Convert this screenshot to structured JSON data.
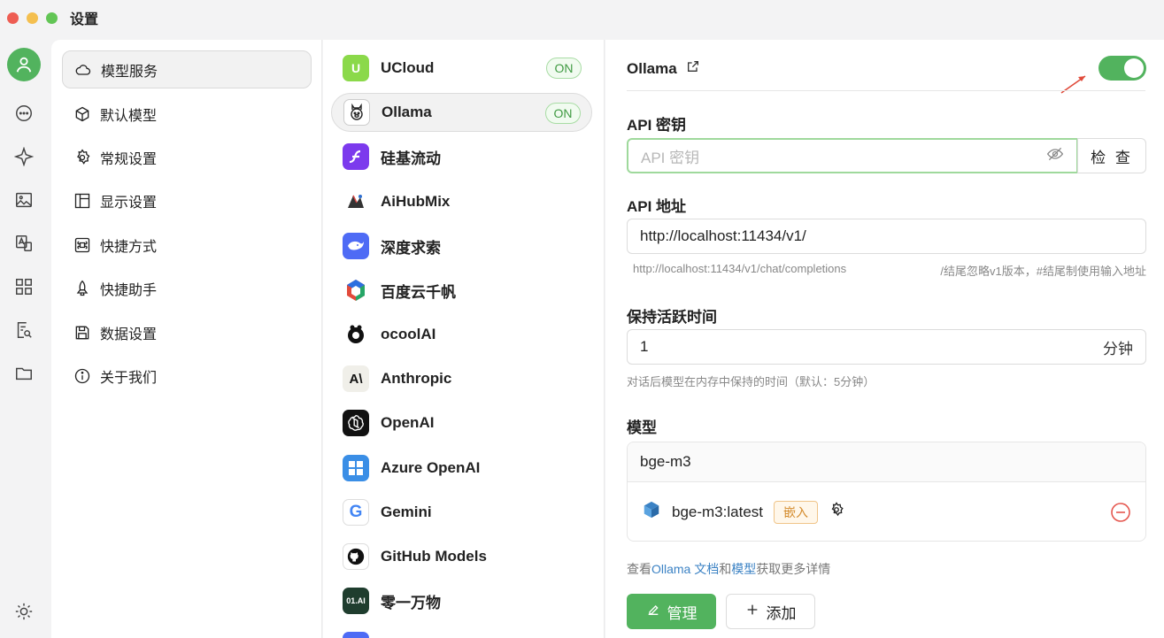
{
  "window": {
    "title": "设置"
  },
  "menu": {
    "items": [
      {
        "label": "模型服务",
        "icon": "cloud-icon",
        "active": true
      },
      {
        "label": "默认模型",
        "icon": "cube-sparkle-icon"
      },
      {
        "label": "常规设置",
        "icon": "gear-icon"
      },
      {
        "label": "显示设置",
        "icon": "layout-icon"
      },
      {
        "label": "快捷方式",
        "icon": "command-icon"
      },
      {
        "label": "快捷助手",
        "icon": "rocket-icon"
      },
      {
        "label": "数据设置",
        "icon": "save-icon"
      },
      {
        "label": "关于我们",
        "icon": "info-icon"
      }
    ]
  },
  "providers": [
    {
      "name": "UCloud",
      "status": "ON",
      "logo": "U"
    },
    {
      "name": "Ollama",
      "status": "ON",
      "active": true,
      "logo": ""
    },
    {
      "name": "硅基流动",
      "logo": ""
    },
    {
      "name": "AiHubMix",
      "logo": ""
    },
    {
      "name": "深度求索",
      "logo": ""
    },
    {
      "name": "百度云千帆",
      "logo": ""
    },
    {
      "name": "ocoolAI",
      "logo": ""
    },
    {
      "name": "Anthropic",
      "logo": "A\\"
    },
    {
      "name": "OpenAI",
      "logo": ""
    },
    {
      "name": "Azure OpenAI",
      "logo": ""
    },
    {
      "name": "Gemini",
      "logo": "G"
    },
    {
      "name": "GitHub Models",
      "logo": ""
    },
    {
      "name": "零一万物",
      "logo": "01.AI"
    }
  ],
  "detail": {
    "title": "Ollama",
    "enabled": true,
    "api_key": {
      "label": "API 密钥",
      "placeholder": "API 密钥",
      "check_label": "检 查"
    },
    "api_url": {
      "label": "API 地址",
      "value": "http://localhost:11434/v1/",
      "hint_left": "http://localhost:11434/v1/chat/completions",
      "hint_right": "/结尾忽略v1版本，#结尾制使用输入地址"
    },
    "keep_alive": {
      "label": "保持活跃时间",
      "value": "1",
      "unit": "分钟",
      "hint": "对话后模型在内存中保持的时间（默认：5分钟）"
    },
    "models": {
      "label": "模型",
      "group": "bge-m3",
      "items": [
        {
          "name": "bge-m3:latest",
          "tag": "嵌入"
        }
      ]
    },
    "help": {
      "prefix": "查看",
      "docs_link": "Ollama 文档",
      "and": "和",
      "models_link": "模型",
      "suffix": "获取更多详情"
    },
    "buttons": {
      "manage": "管理",
      "add": "添加"
    }
  },
  "colors": {
    "accent": "#52b35e",
    "tag_orange": "#d48b2c",
    "danger": "#e5574f",
    "link": "#3b82c4"
  }
}
